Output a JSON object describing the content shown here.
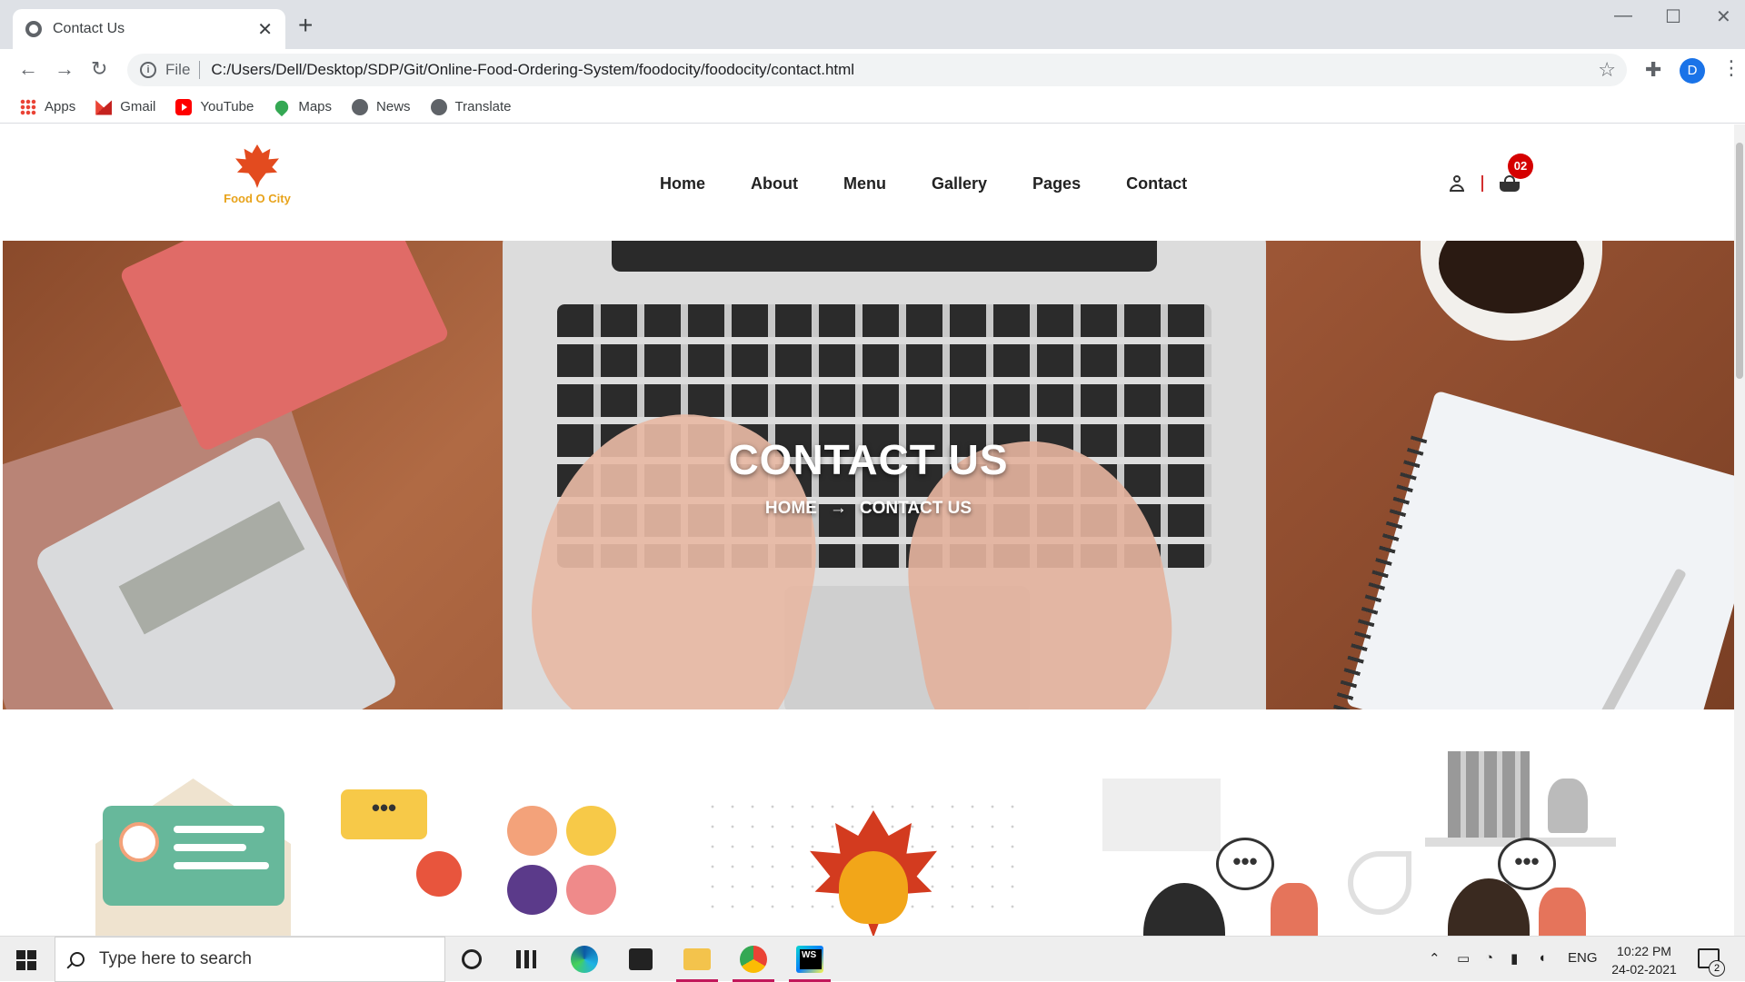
{
  "browser": {
    "tab_title": "Contact Us",
    "close_glyph": "✕",
    "new_tab_glyph": "+",
    "scheme": "File",
    "url": "C:/Users/Dell/Desktop/SDP/Git/Online-Food-Ordering-System/foodocity/foodocity/contact.html",
    "profile_initial": "D",
    "bookmarks": [
      {
        "label": "Apps",
        "icon": "apps-icon"
      },
      {
        "label": "Gmail",
        "icon": "gmail-icon"
      },
      {
        "label": "YouTube",
        "icon": "youtube-icon"
      },
      {
        "label": "Maps",
        "icon": "maps-icon"
      },
      {
        "label": "News",
        "icon": "globe-icon"
      },
      {
        "label": "Translate",
        "icon": "globe-icon"
      }
    ]
  },
  "site": {
    "logo_text": "Food O City",
    "nav": [
      "Home",
      "About",
      "Menu",
      "Gallery",
      "Pages",
      "Contact"
    ],
    "cart_count": "02",
    "hero_title": "CONTACT US",
    "breadcrumb": {
      "home": "HOME",
      "arrow": "→",
      "current": "CONTACT US"
    }
  },
  "illustrations": {
    "left_bubble": "•••",
    "right_bubble_1": "•••",
    "right_bubble_2": "•••"
  },
  "taskbar": {
    "search_placeholder": "Type here to search",
    "language": "ENG",
    "time": "10:22 PM",
    "date": "24-02-2021",
    "notification_count": "2"
  },
  "colors": {
    "accent_red": "#d50000",
    "logo_orange": "#e34b1f",
    "logo_gold": "#e8a31b"
  }
}
